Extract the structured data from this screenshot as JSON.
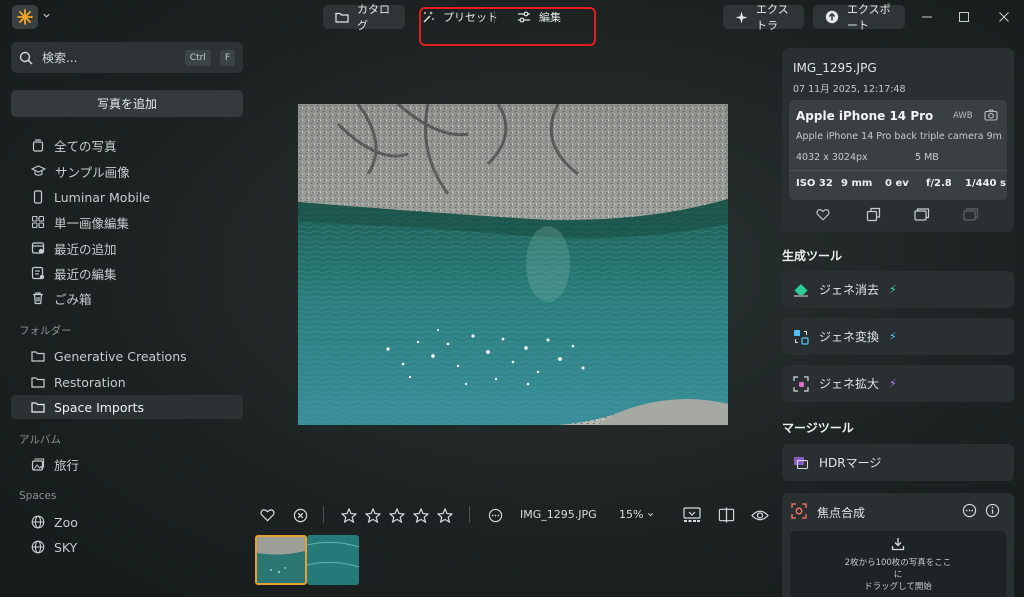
{
  "topbar": {
    "catalog_label": "カタログ",
    "presets_label": "プリセット",
    "edit_label": "編集",
    "extras_label": "エクストラ",
    "export_label": "エクスポート"
  },
  "sidebar": {
    "search_placeholder": "検索...",
    "search_shortcut_ctrl": "Ctrl",
    "search_shortcut_key": "F",
    "add_photos_label": "写真を追加",
    "library_items": [
      {
        "label": "全ての写真",
        "icon": "photos-icon"
      },
      {
        "label": "サンプル画像",
        "icon": "graduation-cap-icon"
      },
      {
        "label": "Luminar Mobile",
        "icon": "phone-icon"
      },
      {
        "label": "単一画像編集",
        "icon": "grid-icon"
      },
      {
        "label": "最近の追加",
        "icon": "recent-added-icon"
      },
      {
        "label": "最近の編集",
        "icon": "recent-edited-icon"
      },
      {
        "label": "ごみ箱",
        "icon": "trash-icon"
      }
    ],
    "folders_label": "フォルダー",
    "folders": [
      {
        "label": "Generative Creations"
      },
      {
        "label": "Restoration"
      },
      {
        "label": "Space Imports",
        "active": true
      }
    ],
    "albums_label": "アルバム",
    "albums": [
      {
        "label": "旅行"
      }
    ],
    "spaces_label": "Spaces",
    "spaces": [
      {
        "label": "Zoo"
      },
      {
        "label": "SKY"
      }
    ]
  },
  "viewer": {
    "filename": "IMG_1295.JPG",
    "zoom": "15%",
    "rating_stars": 5,
    "rating_value": 0
  },
  "info": {
    "filename": "IMG_1295.JPG",
    "datetime": "07 11月 2025, 12:17:48",
    "camera": "Apple iPhone 14 Pro",
    "wb": "AWB",
    "lens": "Apple iPhone 14 Pro back triple camera 9m",
    "resolution": "4032 x 3024px",
    "filesize": "5 MB",
    "iso": "ISO 32",
    "focal": "9 mm",
    "ev": "0 ev",
    "aperture": "f/2.8",
    "shutter": "1/440 s"
  },
  "gen_tools": {
    "title": "生成ツール",
    "items": [
      {
        "label": "ジェネ消去",
        "bolt_color": "#2ee0a0"
      },
      {
        "label": "ジェネ変換",
        "bolt_color": "#4fc3ff"
      },
      {
        "label": "ジェネ拡大",
        "bolt_color": "#b07bff"
      }
    ]
  },
  "merge_tools": {
    "title": "マージツール",
    "hdr_label": "HDRマージ",
    "focus_label": "焦点合成",
    "drop_text_line1": "2枚から100枚の写真をここ",
    "drop_text_line2": "に",
    "drop_text_line3": "ドラッグして開始"
  },
  "colors": {
    "accent_orange": "#e8a030",
    "highlight_red": "#e21d1d",
    "panel_bg": "#2a3032"
  }
}
